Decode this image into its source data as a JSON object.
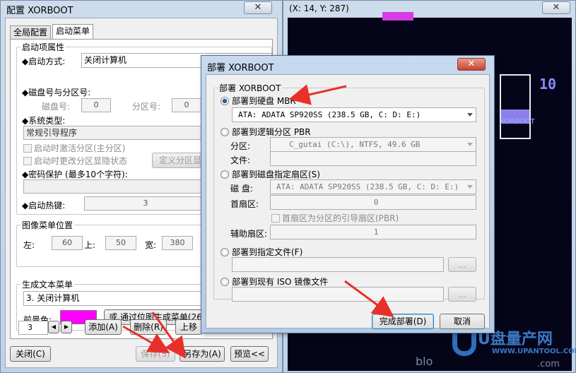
{
  "config_window": {
    "title": "配置 XORBOOT",
    "close_glyph": "✕",
    "tabs": [
      {
        "label": "全局配置"
      },
      {
        "label": "启动菜单"
      }
    ],
    "boot_props": {
      "title": "启动项属性",
      "boot_mode_label": "◆启动方式:",
      "boot_mode_value": "关闭计算机",
      "disk_part_label": "◆磁盘号与分区号:",
      "disk_no_label": "磁盘号:",
      "disk_no_value": "0",
      "part_no_label": "分区号:",
      "part_no_value": "0",
      "sys_type_label": "◆系统类型:",
      "sys_type_value": "常规引导程序",
      "chk_activate": "启动时激活分区(主分区)",
      "chk_hide": "启动时更改分区显隐状态",
      "define_part_btn": "定义分区显",
      "password_label": "◆密码保护 (最多10个字符):",
      "hotkey_label": "◆启动热键:",
      "hotkey_value": "3"
    },
    "image_pos": {
      "title": "图像菜单位置",
      "left_label": "左:",
      "left_value": "60",
      "top_label": "上:",
      "top_value": "50",
      "width_label": "宽:",
      "width_value": "380"
    },
    "text_menu": {
      "title": "生成文本菜单",
      "item": "3. 关闭计算机",
      "fg_label": "前景色:",
      "fg_color": "#ff00ff",
      "gen_btn": "或,通过位图生成菜单(26"
    },
    "spinner_value": "3",
    "add_btn": "添加(A)",
    "delete_btn": "删除(R)",
    "up_btn": "上移",
    "close_btn": "关闭(C)",
    "save_btn": "保存(S)",
    "save_as_btn": "另存为(A)",
    "preview_btn": "预览<<"
  },
  "preview_window": {
    "title": "(X: 14, Y: 287)",
    "close_glyph": "✕",
    "counter": "10",
    "caption": "XORBOOT"
  },
  "deploy_dialog": {
    "title": "部署 XORBOOT",
    "close_glyph": "✕",
    "group_title": "部署 XORBOOT",
    "opt_mbr": "部署到硬盘 MBR",
    "mbr_disk": "ATA: ADATA SP920SS (238.5 GB, C: D: E:)",
    "opt_pbr": "部署到逻辑分区 PBR",
    "part_label": "分区:",
    "part_value": "C_gutai (C:\\),  NTFS,  49.6 GB",
    "file_label": "文件:",
    "opt_sector": "部署到磁盘指定扇区(S)",
    "disk_label": "磁  盘:",
    "disk_value": "ATA: ADATA SP920SS (238.5 GB, C: D: E:)",
    "first_sector_label": "首扇区:",
    "first_sector_value": "0",
    "first_is_pbr": "首扇区为分区的引导扇区(PBR)",
    "aux_sector_label": "辅助扇区:",
    "aux_sector_value": "1",
    "opt_file": "部署到指定文件(F)",
    "browse": "...",
    "opt_iso": "部署到现有 ISO 镜像文件",
    "finish_btn": "完成部署(D)",
    "cancel_btn": "取消"
  },
  "watermark": {
    "brand_big": "U盘量产网",
    "url": "WWW.UPANTOOL.COM",
    "blog": "blo",
    "blog_tail": ".com"
  },
  "colors": {
    "annotation_arrow": "#e8302a",
    "accent": "#3c7fb1"
  }
}
